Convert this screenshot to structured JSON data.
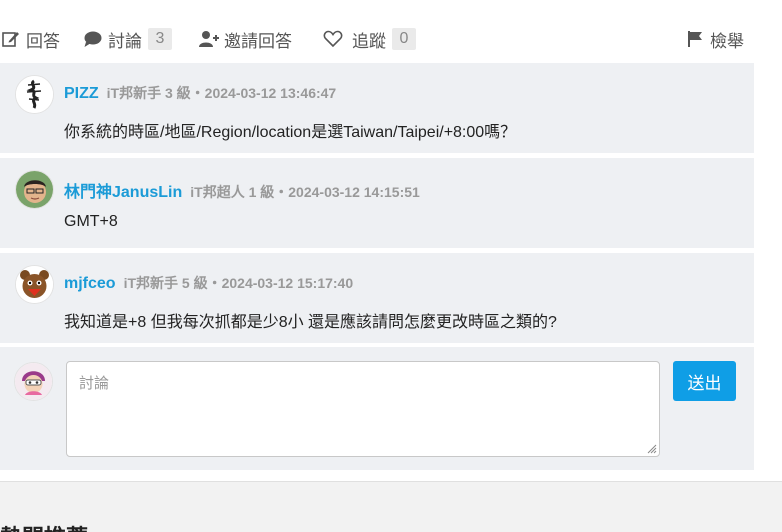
{
  "actions": {
    "answer": {
      "label": "回答",
      "icon": "edit-icon"
    },
    "comment": {
      "label": "討論",
      "count": "3",
      "icon": "comment-icon"
    },
    "invite": {
      "label": "邀請回答",
      "icon": "user-plus-icon"
    },
    "follow": {
      "label": "追蹤",
      "count": "0",
      "icon": "heart-icon"
    },
    "report": {
      "label": "檢舉",
      "icon": "flag-icon"
    }
  },
  "comments": [
    {
      "author": "PIZZ",
      "info": "iT邦新手 3 級・2024-03-12 13:46:47",
      "text": "你系統的時區/地區/Region/location是選Taiwan/Taipei/+8:00嗎？"
    },
    {
      "author": "林門神JanusLin",
      "info": "iT邦超人 1 級・2024-03-12 14:15:51",
      "text": "GMT+8"
    },
    {
      "author": "mjfceo",
      "info": "iT邦新手 5 級・2024-03-12 15:17:40",
      "text": "我知道是+8 但我每次抓都是少8小 還是應該請問怎麼更改時區之類的?"
    }
  ],
  "reply": {
    "placeholder": "討論",
    "value": "",
    "submit_label": "送出"
  },
  "next_section": {
    "title": "熱門推薦"
  },
  "colors": {
    "accent": "#1b9bd7",
    "button": "#0f9ee6",
    "panel": "#eef0f3"
  }
}
